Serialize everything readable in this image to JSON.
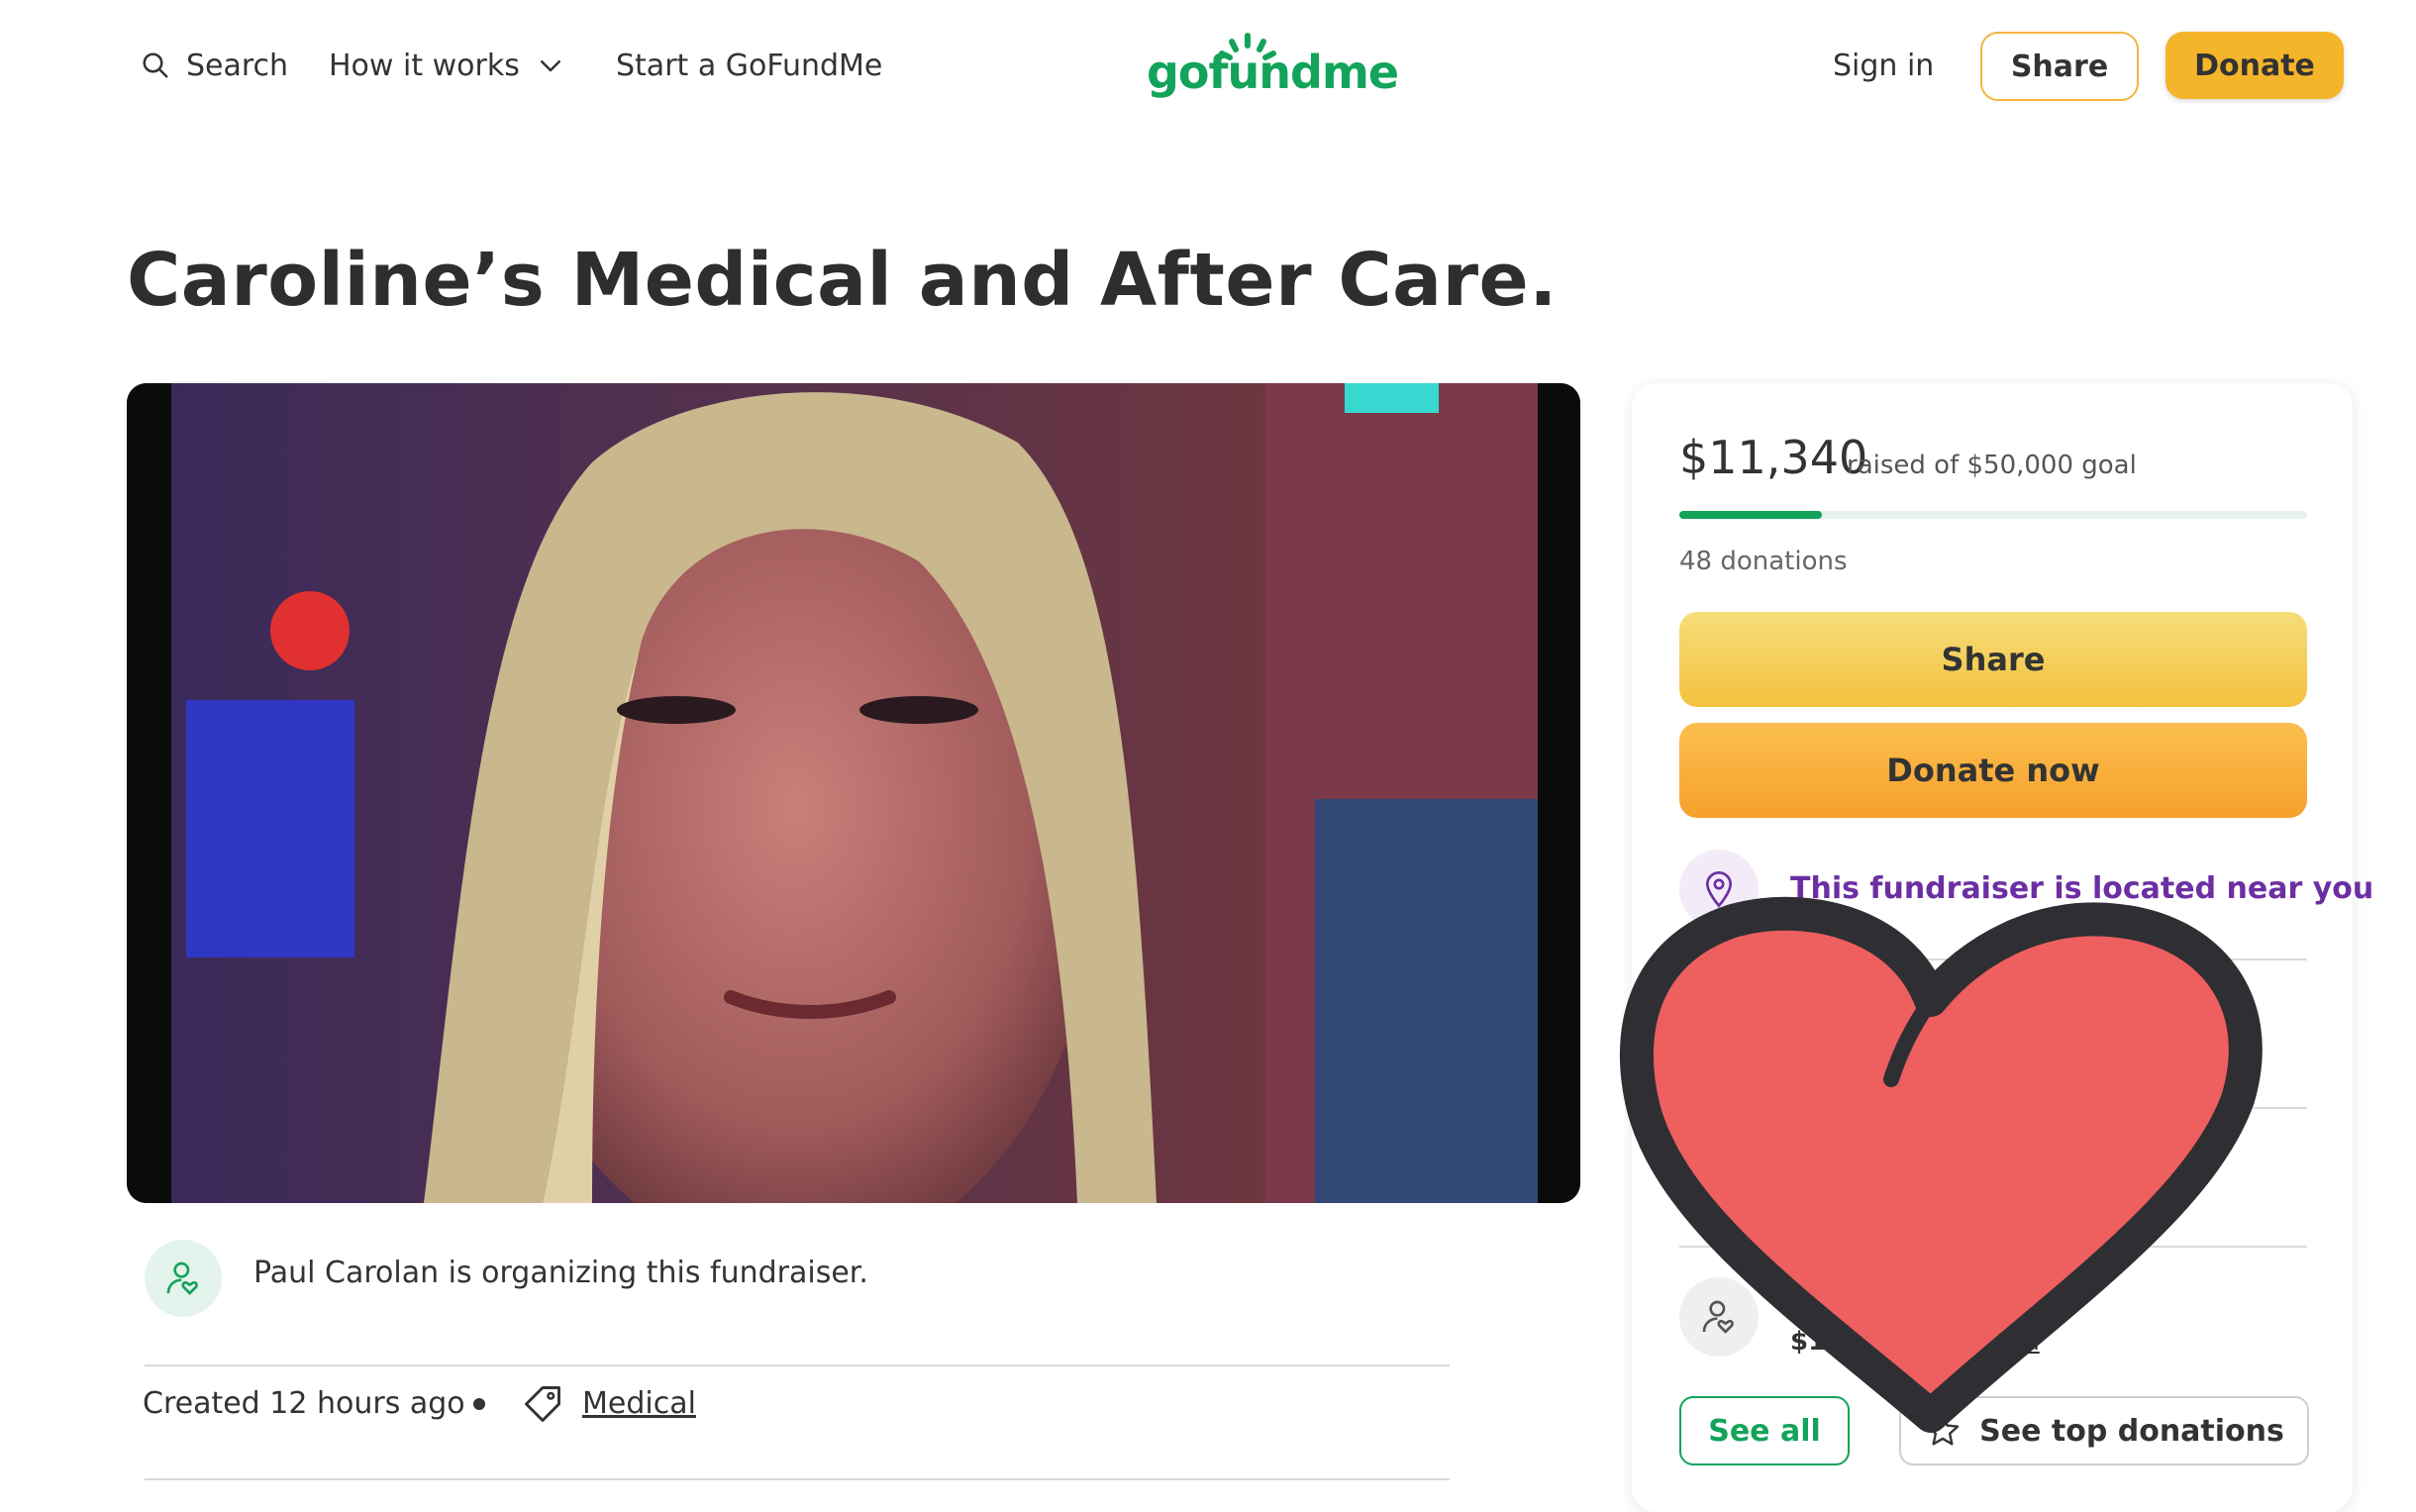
{
  "header": {
    "search_label": "Search",
    "how_it_works_label": "How it works",
    "start_label": "Start a GoFundMe",
    "logo_text": "gofundme",
    "sign_in_label": "Sign in",
    "share_label": "Share",
    "donate_label": "Donate"
  },
  "page": {
    "title": "Caroline’s Medical and After Care."
  },
  "organizer": {
    "text": "Paul Carolan is organizing this fundraiser."
  },
  "meta": {
    "created": "Created 12 hours ago",
    "category": "Medical"
  },
  "card": {
    "raised": "$11,340",
    "goal_text": "raised of $50,000 goal",
    "progress_fraction": 0.2268,
    "donations_count": "48 donations",
    "share_button": "Share",
    "donate_button": "Donate now",
    "location_text": "This fundraiser is located near you",
    "donor_amount": "$100",
    "donor_sub_fragment": "tion",
    "see_all_button": "See all",
    "top_donations_button": "See top donations"
  },
  "colors": {
    "brand_green": "#13a35b",
    "donate_orange": "#f5b52b",
    "location_purple": "#6c2fa3",
    "heart_red": "#ee5f5f"
  },
  "icons": [
    "search-icon",
    "chevron-down-icon",
    "organizer-icon",
    "tag-icon",
    "location-pin-icon",
    "donor-icon",
    "star-icon",
    "heart-sticker"
  ]
}
